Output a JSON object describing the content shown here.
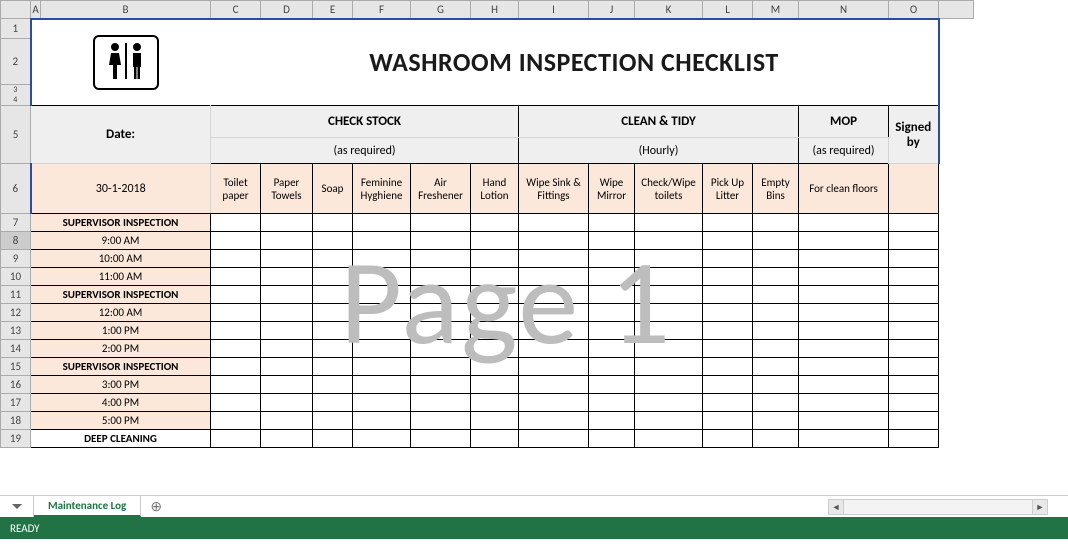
{
  "title": "WASHROOM INSPECTION CHECKLIST",
  "watermark": "Page 1",
  "columns": [
    "A",
    "B",
    "C",
    "D",
    "E",
    "F",
    "G",
    "H",
    "I",
    "J",
    "K",
    "L",
    "M",
    "N",
    "O"
  ],
  "rows": [
    "1",
    "2",
    "3",
    "4",
    "5",
    "6",
    "7",
    "8",
    "9",
    "10",
    "11",
    "12",
    "13",
    "14",
    "15",
    "16",
    "17",
    "18",
    "19"
  ],
  "selected_row": "8",
  "date_label": "Date:",
  "date_value": "30-1-2018",
  "groups": {
    "checkstock": {
      "title": "CHECK STOCK",
      "sub": "(as required)"
    },
    "cleantidy": {
      "title": "CLEAN & TIDY",
      "sub": "(Hourly)"
    },
    "mop": {
      "title": "MOP",
      "sub": "(as required)"
    },
    "signed": {
      "title": "Signed by"
    }
  },
  "subheaders": {
    "c": "Toilet paper",
    "d": "Paper Towels",
    "e": "Soap",
    "f": "Feminine Hyghiene",
    "g": "Air Freshener",
    "h": "Hand Lotion",
    "i": "Wipe Sink & Fittings",
    "j": "Wipe Mirror",
    "k": "Check/Wipe toilets",
    "l": "Pick Up Litter",
    "m": "Empty Bins",
    "n": "For clean floors"
  },
  "body_rows": [
    {
      "type": "sup",
      "label": "SUPERVISOR INSPECTION"
    },
    {
      "type": "time",
      "label": "9:00 AM"
    },
    {
      "type": "time",
      "label": "10:00 AM"
    },
    {
      "type": "time",
      "label": "11:00 AM"
    },
    {
      "type": "sup",
      "label": "SUPERVISOR INSPECTION"
    },
    {
      "type": "time",
      "label": "12:00 AM"
    },
    {
      "type": "time",
      "label": "1:00 PM"
    },
    {
      "type": "time",
      "label": "2:00 PM"
    },
    {
      "type": "sup",
      "label": "SUPERVISOR INSPECTION"
    },
    {
      "type": "time",
      "label": "3:00 PM"
    },
    {
      "type": "time",
      "label": "4:00 PM"
    },
    {
      "type": "time",
      "label": "5:00 PM"
    },
    {
      "type": "deep",
      "label": "DEEP CLEANING"
    }
  ],
  "tab": {
    "name": "Maintenance Log"
  },
  "status": "READY",
  "icon_names": {
    "restroom": "restroom-icon"
  }
}
